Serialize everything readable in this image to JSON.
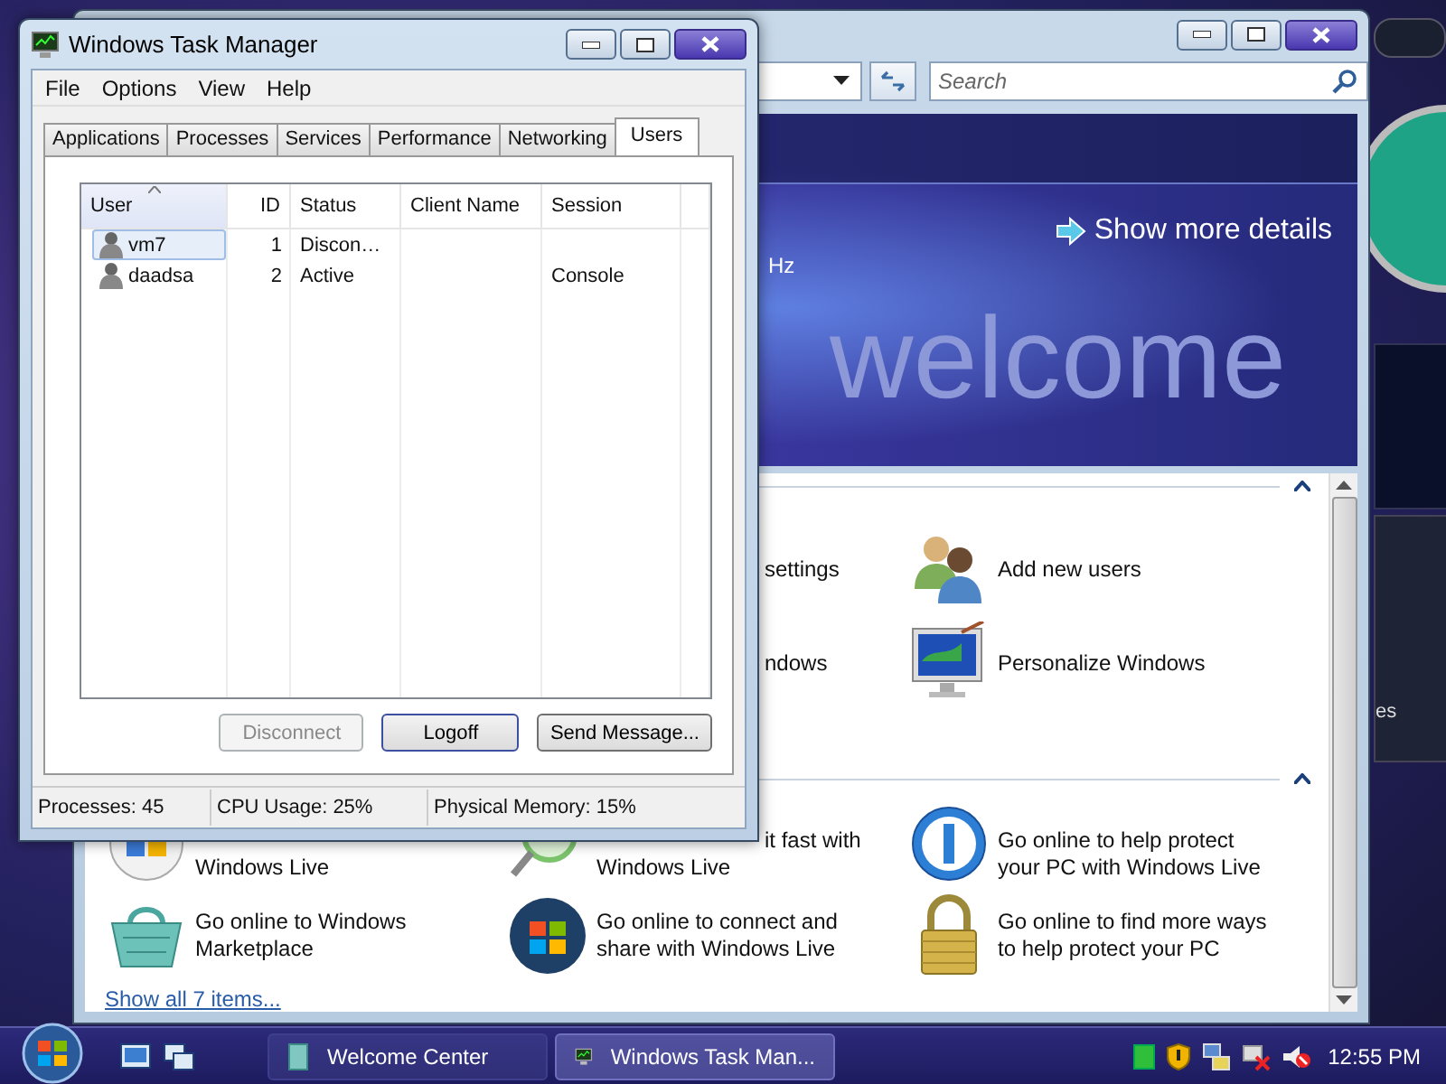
{
  "desktop": {
    "gadget_text": "es"
  },
  "welcome_center": {
    "search": {
      "placeholder": "Search"
    },
    "banner": {
      "detail_text": "Hz",
      "link": "Show more details",
      "watermark": "welcome"
    },
    "sections": [
      {
        "rows": [
          [
            {
              "lines": [
                "settings"
              ],
              "clipped": true
            },
            {
              "lines": [
                "Add new users"
              ],
              "clipped": false
            }
          ],
          [
            {
              "lines": [
                "ndows"
              ],
              "clipped": true
            },
            {
              "lines": [
                "Personalize Windows"
              ],
              "clipped": false
            }
          ]
        ]
      },
      {
        "rows": [
          [
            {
              "lines": [
                "Windows Live"
              ],
              "clipped": false
            },
            {
              "lines": [
                "it fast with",
                "Windows Live"
              ],
              "clipped": true
            },
            {
              "lines": [
                "Go online to help protect",
                "your PC with Windows Live"
              ],
              "clipped": false
            }
          ],
          [
            {
              "lines": [
                "Go online to Windows",
                "Marketplace"
              ],
              "clipped": false
            },
            {
              "lines": [
                "Go online to connect and",
                "share with Windows Live"
              ],
              "clipped": false
            },
            {
              "lines": [
                "Go online to find more ways",
                "to help protect your PC"
              ],
              "clipped": false
            }
          ]
        ]
      }
    ],
    "show_all_link": "Show all 7 items..."
  },
  "task_manager": {
    "title": "Windows Task Manager",
    "menu": [
      "File",
      "Options",
      "View",
      "Help"
    ],
    "tabs": [
      {
        "label": "Applications",
        "selected": false
      },
      {
        "label": "Processes",
        "selected": false
      },
      {
        "label": "Services",
        "selected": false
      },
      {
        "label": "Performance",
        "selected": false
      },
      {
        "label": "Networking",
        "selected": false
      },
      {
        "label": "Users",
        "selected": true
      }
    ],
    "columns": [
      "User",
      "ID",
      "Status",
      "Client Name",
      "Session"
    ],
    "rows": [
      {
        "cells": [
          "vm7",
          "1",
          "Discon…",
          "",
          ""
        ],
        "selected": true
      },
      {
        "cells": [
          "daadsa",
          "2",
          "Active",
          "",
          "Console"
        ],
        "selected": false
      }
    ],
    "buttons": [
      {
        "label": "Disconnect",
        "disabled": true
      },
      {
        "label": "Logoff",
        "disabled": false
      },
      {
        "label": "Send Message...",
        "disabled": false
      }
    ],
    "status_bar": [
      "Processes: 45",
      "CPU Usage: 25%",
      "Physical Memory: 15%"
    ]
  },
  "taskbar": {
    "tasks": [
      {
        "label": "Welcome Center",
        "selected": false
      },
      {
        "label": "Windows Task Man...",
        "selected": true
      }
    ],
    "clock": "12:55 PM"
  }
}
